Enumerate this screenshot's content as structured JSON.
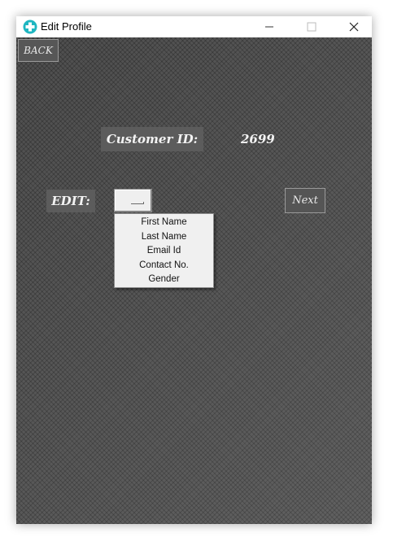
{
  "window": {
    "title": "Edit Profile",
    "icon": "teal-plus-icon",
    "controls": {
      "minimize": "minimize-icon",
      "maximize": "maximize-icon",
      "close": "close-icon"
    }
  },
  "back_button": {
    "label": "BACK"
  },
  "customer": {
    "label": "Customer ID:",
    "value": "2699"
  },
  "edit": {
    "label": "EDIT:",
    "options": [
      "First Name",
      "Last Name",
      "Email Id",
      "Contact No.",
      "Gender"
    ]
  },
  "next_button": {
    "label": "Next"
  },
  "colors": {
    "background": "#4e4e4e",
    "icon_accent": "#1fb6c1"
  }
}
